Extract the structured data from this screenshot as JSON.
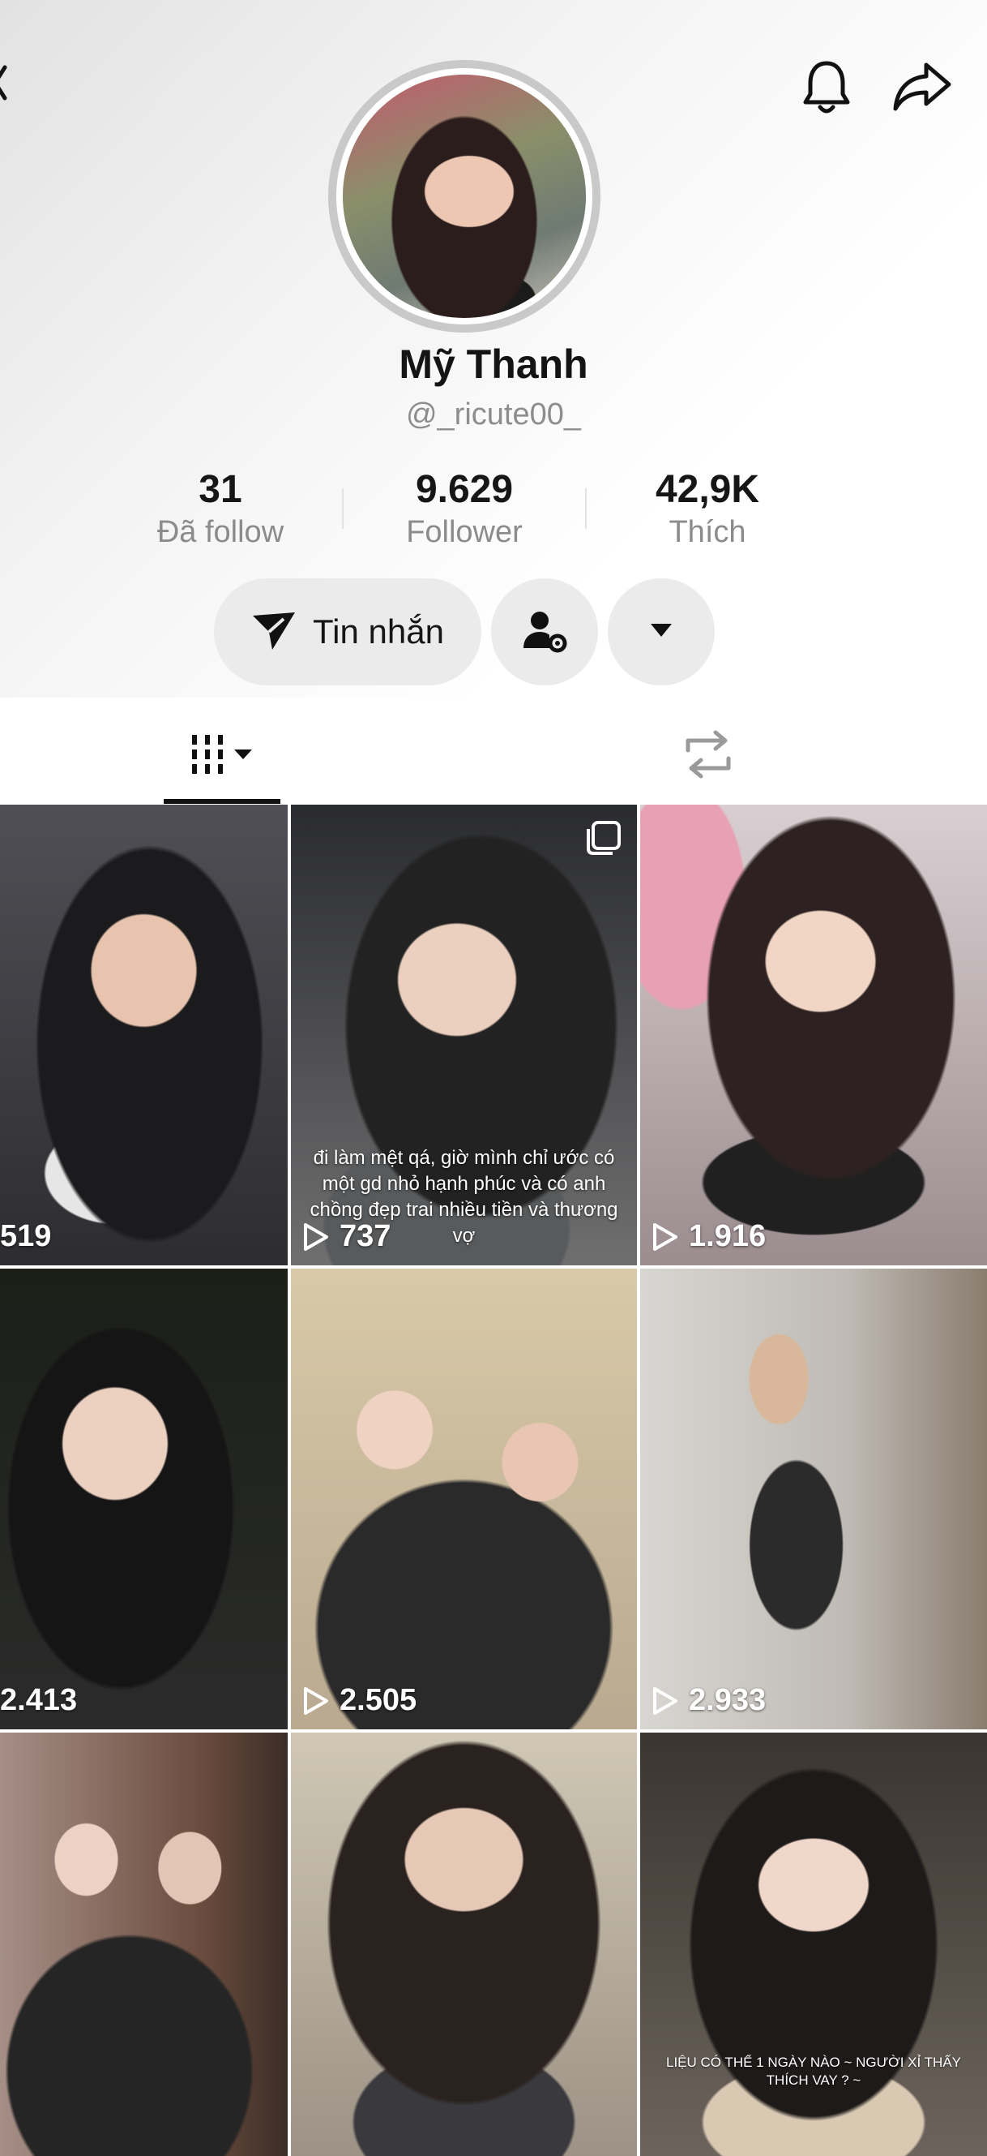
{
  "profile": {
    "name": "Mỹ Thanh",
    "handle": "@_ricute00_"
  },
  "stats": [
    {
      "value": "31",
      "label": "Đã follow"
    },
    {
      "value": "9.629",
      "label": "Follower"
    },
    {
      "value": "42,9K",
      "label": "Thích"
    }
  ],
  "actions": {
    "message_label": "Tin nhắn"
  },
  "icons": {
    "header": [
      "bell-icon",
      "share-icon"
    ],
    "actions": [
      "send-icon",
      "person-settings-icon",
      "caret-down-icon"
    ],
    "tabs": [
      "grid-icon",
      "repost-icon"
    ]
  },
  "videos": [
    {
      "views": "519"
    },
    {
      "views": "737",
      "caption": "đi làm mệt qá, giờ mình chỉ ước có một gd nhỏ hạnh phúc và có anh chồng đẹp trai nhiều tiền và thương vợ",
      "multi_image": true
    },
    {
      "views": "1.916"
    },
    {
      "views": "2.413"
    },
    {
      "views": "2.505"
    },
    {
      "views": "2.933"
    },
    {
      "views": ""
    },
    {
      "views": ""
    },
    {
      "views": "",
      "caption": "LIỆU CÓ THỂ 1 NGÀY NÀO ~ NGƯỜI XỈ THẤY THÍCH VAY ? ~"
    }
  ]
}
